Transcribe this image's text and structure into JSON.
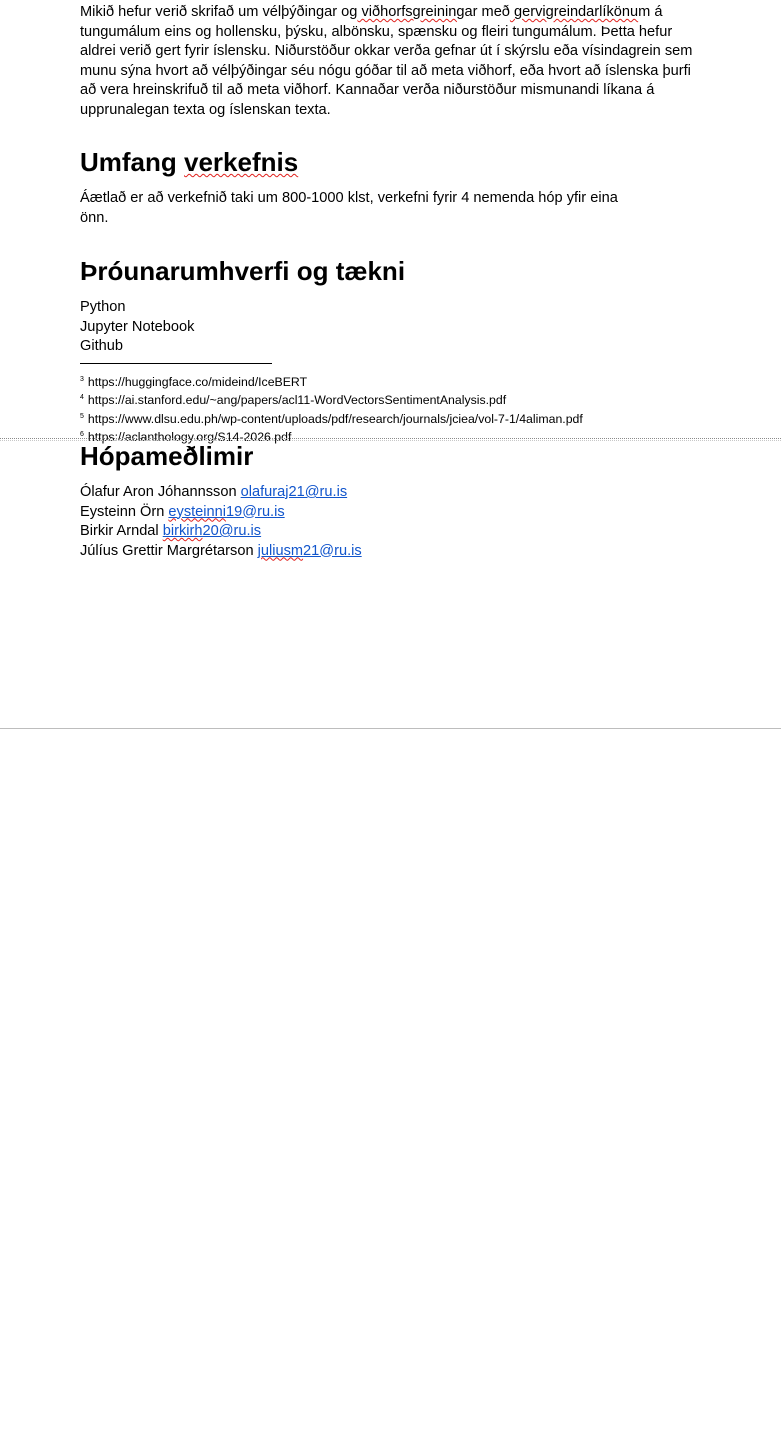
{
  "intro": {
    "t1": "Mikið hefur verið skrifað um vélþýðingar og",
    "w1": " viðhorfsgreining",
    "t2": "ar með",
    "w2": " gervigreindarlíkönu",
    "t3": "m á tungumálum eins og hollensku, þýsku, albönsku, spænsku og fleiri tungumálum. Þetta hefur aldrei verið gert fyrir íslensku. Niðurstöður okkar verða gefnar út í skýrslu eða vísindagrein sem munu sýna hvort að vélþýðingar séu nógu góðar til að meta viðhorf, eða hvort að íslenska þurfi að vera hreinskrifuð til að meta viðhorf. Kannaðar verða niðurstöður mismunandi líkana á upprunalegan texta og íslenskan texta."
  },
  "scope": {
    "heading_a": "Umfang ",
    "heading_b": "verkefnis",
    "text": "Áætlað er að verkefnið taki um 800-1000 klst, verkefni fyrir 4 nemenda hóp yfir eina önn."
  },
  "tech": {
    "heading": "Þróunarumhverfi og tækni",
    "items": [
      "Python",
      "Jupyter Notebook",
      "Github"
    ]
  },
  "footnotes": [
    {
      "num": "3",
      "text": "https://huggingface.co/mideind/IceBERT"
    },
    {
      "num": "4",
      "text": "https://ai.stanford.edu/~ang/papers/acl11-WordVectorsSentimentAnalysis.pdf"
    },
    {
      "num": "5",
      "text": "https://www.dlsu.edu.ph/wp-content/uploads/pdf/research/journals/jciea/vol-7-1/4aliman.pdf"
    },
    {
      "num": "6",
      "text": "https://aclanthology.org/S14-2026.pdf"
    }
  ],
  "members": {
    "heading": "Hópameðlimir",
    "list": [
      {
        "name": "Ólafur Aron Jóhannsson",
        "email_a": "",
        "email_sq": "",
        "email_b": "olafuraj21@ru.is"
      },
      {
        "name": "Eysteinn Örn",
        "email_a": "",
        "email_sq": "eysteinni",
        "email_b": "19@ru.is"
      },
      {
        "name": "Birkir Arndal",
        "email_a": "",
        "email_sq": "birkirh",
        "email_b": "20@ru.is"
      },
      {
        "name": "Júlíus Grettir Margrétarson",
        "email_a": "",
        "email_sq": "juliusm",
        "email_b": "21@ru.is"
      }
    ]
  },
  "colors": {
    "link": "#1155cc",
    "spellcheck": "#e0201c"
  }
}
